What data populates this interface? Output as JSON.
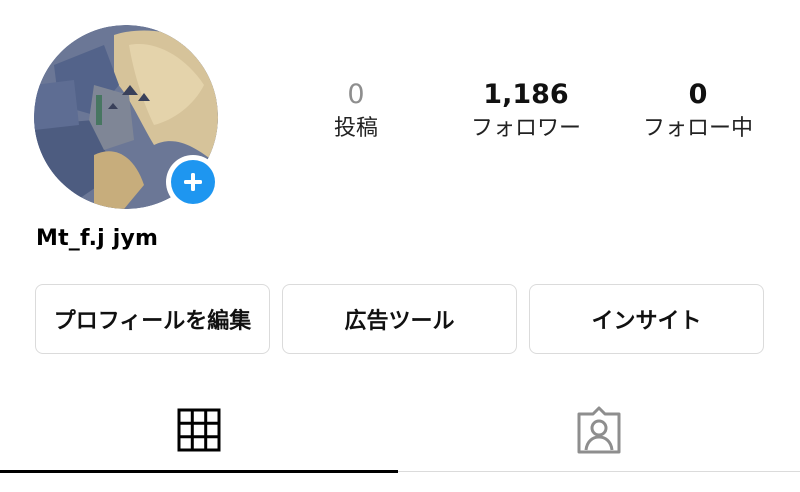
{
  "profile": {
    "username": "Mt_f.j jym",
    "avatar_icon": "profile-photo",
    "add_icon": "plus-icon"
  },
  "stats": [
    {
      "value": "0",
      "label": "投稿"
    },
    {
      "value": "1,186",
      "label": "フォロワー"
    },
    {
      "value": "0",
      "label": "フォロー中"
    }
  ],
  "actions": {
    "edit_profile": "プロフィールを編集",
    "ad_tools": "広告ツール",
    "insights": "インサイト"
  },
  "tabs": {
    "grid_icon": "grid-icon",
    "tagged_icon": "tagged-user-icon"
  },
  "colors": {
    "accent": "#1e96f0",
    "border": "#dbdbdb",
    "muted": "#8e8e8e"
  }
}
